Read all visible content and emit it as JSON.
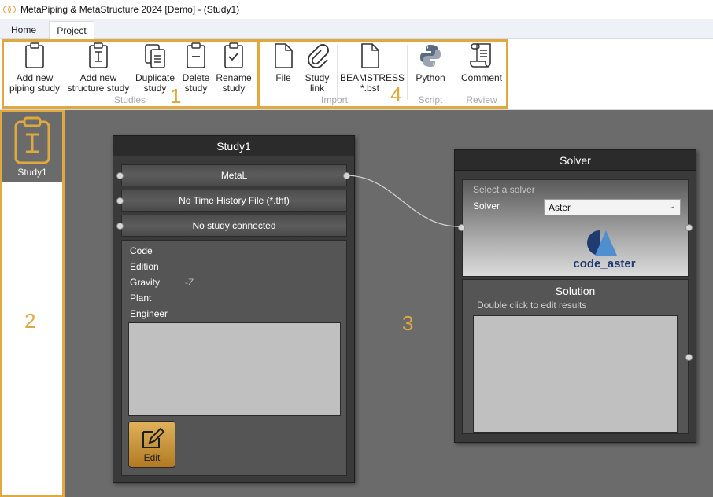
{
  "window": {
    "title": "MetaPiping & MetaStructure 2024 [Demo] - (Study1)"
  },
  "tabs": [
    {
      "label": "Home",
      "active": false
    },
    {
      "label": "Project",
      "active": true
    }
  ],
  "ribbon": {
    "groups": [
      {
        "label": "Studies",
        "number": "1",
        "buttons": [
          {
            "label": "Add new\npiping study",
            "icon": "clipboard-icon"
          },
          {
            "label": "Add new\nstructure study",
            "icon": "clipboard-beam-icon"
          },
          {
            "label": "Duplicate\nstudy",
            "icon": "duplicate-icon"
          },
          {
            "label": "Delete\nstudy",
            "icon": "clipboard-minus-icon"
          },
          {
            "label": "Rename\nstudy",
            "icon": "clipboard-check-icon"
          }
        ]
      },
      {
        "label": "Import",
        "number": "4",
        "buttons": [
          {
            "label": "File",
            "icon": "file-icon"
          },
          {
            "label": "Study\nlink",
            "icon": "paperclip-icon"
          },
          {
            "label": "BEAMSTRESS\n*.bst",
            "icon": "file-icon"
          }
        ]
      },
      {
        "label": "Script",
        "buttons": [
          {
            "label": "Python",
            "icon": "python-icon"
          }
        ]
      },
      {
        "label": "Review",
        "buttons": [
          {
            "label": "Comment",
            "icon": "scroll-icon"
          }
        ]
      }
    ]
  },
  "sidebar": {
    "number": "2",
    "items": [
      {
        "label": "Study1",
        "icon": "clipboard-beam-icon",
        "selected": true
      }
    ]
  },
  "canvas": {
    "number": "3",
    "study_node": {
      "title": "Study1",
      "slots": [
        "MetaL",
        "No Time History File (*.thf)",
        "No study connected"
      ],
      "fields": [
        {
          "label": "Code",
          "value": ""
        },
        {
          "label": "Edition",
          "value": ""
        },
        {
          "label": "Gravity",
          "value": "-Z"
        },
        {
          "label": "Plant",
          "value": ""
        },
        {
          "label": "Engineer",
          "value": ""
        }
      ],
      "edit_label": "Edit"
    },
    "solver_node": {
      "title": "Solver",
      "placeholder": "Select a solver",
      "solver_label": "Solver",
      "solver_value": "Aster",
      "logo_text": "code_aster",
      "solution_title": "Solution",
      "solution_hint": "Double click to edit results"
    }
  },
  "colors": {
    "accent": "#e0a940",
    "canvas": "#6b6b6b",
    "node": "#3a3a3a",
    "logo": "#1f3b72"
  }
}
